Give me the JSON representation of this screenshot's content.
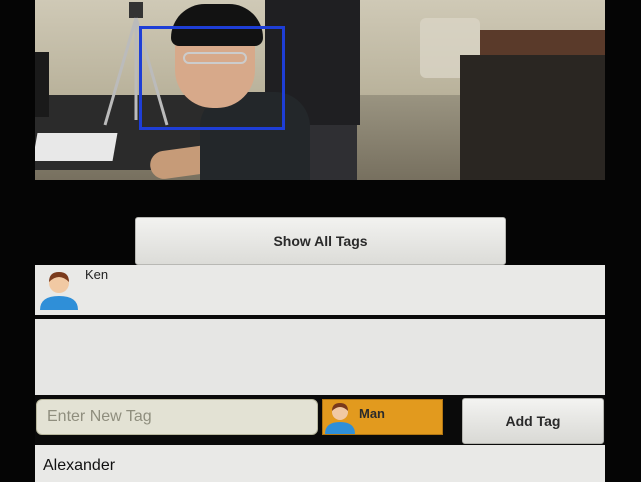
{
  "preview": {
    "face_box_color": "#1e3ed6"
  },
  "buttons": {
    "show_all_tags": "Show All Tags",
    "add_tag": "Add Tag"
  },
  "tags": [
    {
      "name": "Ken",
      "icon": "user-avatar-icon"
    }
  ],
  "entry": {
    "placeholder": "Enter New Tag",
    "value": ""
  },
  "gender_chip": {
    "label": "Man",
    "icon": "man-avatar-icon",
    "color": "#e29a1e"
  },
  "suggestions": [
    "Alexander"
  ]
}
